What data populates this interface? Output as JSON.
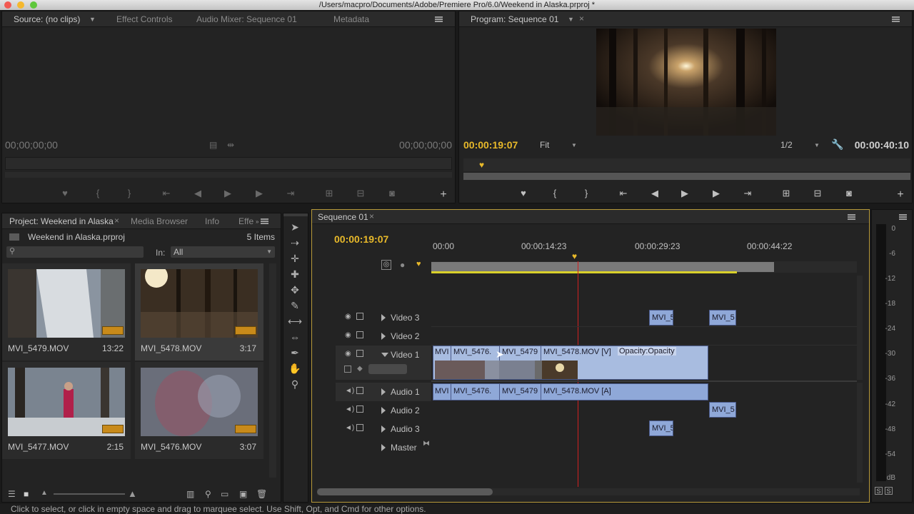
{
  "window": {
    "title": "/Users/macpro/Documents/Adobe/Premiere Pro/6.0/Weekend in Alaska.prproj *"
  },
  "source_panel": {
    "tabs": [
      "Source: (no clips)",
      "Effect Controls",
      "Audio Mixer: Sequence 01",
      "Metadata"
    ],
    "timecode_left": "00;00;00;00",
    "timecode_right": "00;00;00;00"
  },
  "program_panel": {
    "tab": "Program: Sequence 01",
    "timecode_current": "00:00:19:07",
    "fit": "Fit",
    "resolution": "1/2",
    "timecode_duration": "00:00:40:10"
  },
  "project_panel": {
    "tabs": [
      "Project: Weekend in Alaska",
      "Media Browser",
      "Info",
      "Effe"
    ],
    "project_file": "Weekend in Alaska.prproj",
    "item_count": "5 Items",
    "in_label": "In:",
    "in_value": "All",
    "items": [
      {
        "name": "MVI_5479.MOV",
        "duration": "13:22"
      },
      {
        "name": "MVI_5478.MOV",
        "duration": "3:17"
      },
      {
        "name": "MVI_5477.MOV",
        "duration": "2:15"
      },
      {
        "name": "MVI_5476.MOV",
        "duration": "3:07"
      }
    ]
  },
  "timeline": {
    "tab": "Sequence 01",
    "timecode": "00:00:19:07",
    "ruler": [
      "00:00",
      "00:00:14:23",
      "00:00:29:23",
      "00:00:44:22"
    ],
    "tracks": {
      "video3": "Video 3",
      "video2": "Video 2",
      "video1": "Video 1",
      "audio1": "Audio 1",
      "audio2": "Audio 2",
      "audio3": "Audio 3",
      "master": "Master"
    },
    "clips": {
      "v3_a": "MVI_5",
      "v3_b": "MVI_5",
      "v1_a": "MVI",
      "v1_b": "MVI_5476.",
      "v1_c": "MVI_5479",
      "v1_d": "MVI_5478.MOV [V]",
      "v1_opacity": "Opacity:Opacity",
      "a1_a": "MVI",
      "a1_b": "MVI_5476.",
      "a1_c": "MVI_5479",
      "a1_d": "MVI_5478.MOV [A]",
      "a2": "MVI_5",
      "a3": "MVI_5"
    }
  },
  "audio_meter": {
    "labels": [
      "0",
      "-6",
      "-12",
      "-18",
      "-24",
      "-30",
      "-36",
      "-42",
      "-48",
      "-54",
      "dB"
    ],
    "solo": [
      "S",
      "S"
    ]
  },
  "status_bar": "Click to select, or click in empty space and drag to marquee select. Use Shift, Opt, and Cmd for other options.",
  "colors": {
    "accent": "#e8b92a",
    "clip": "#8fa8d8",
    "playhead": "#d02020",
    "panel": "#232323"
  }
}
